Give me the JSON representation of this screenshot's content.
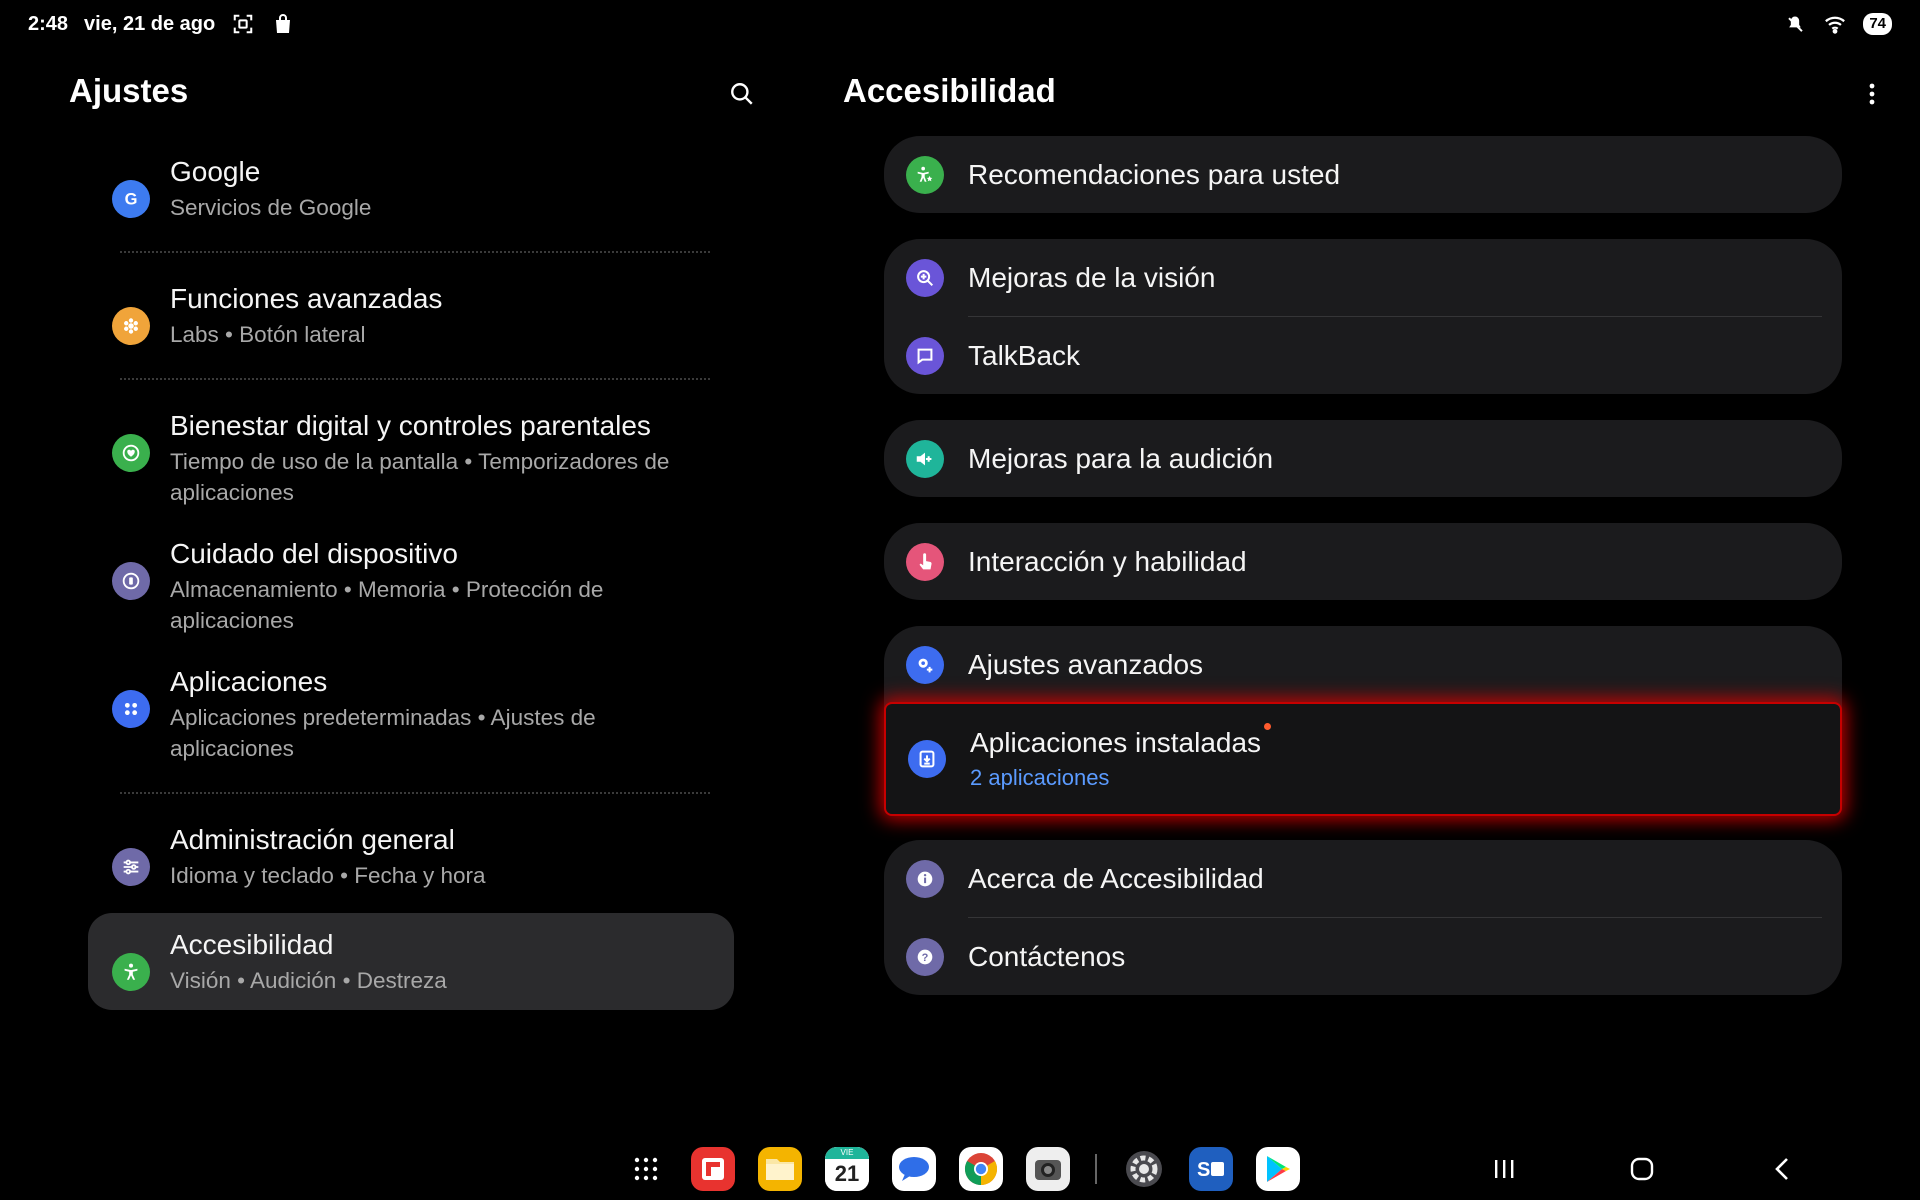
{
  "status_bar": {
    "time": "2:48",
    "date": "vie, 21 de ago",
    "battery": "74",
    "icons": [
      "screenshot-icon",
      "bag-icon",
      "mute-icon",
      "wifi-icon",
      "battery-icon"
    ]
  },
  "left_pane": {
    "title": "Ajustes",
    "items": [
      {
        "icon": "google-icon",
        "color": "#3d7bf0",
        "title": "Google",
        "subtitle": "Servicios de Google"
      },
      {
        "icon": "advanced-features-icon",
        "color": "#f0a43a",
        "title": "Funciones avanzadas",
        "subtitle": "Labs  •  Botón lateral"
      },
      {
        "icon": "digital-wellbeing-icon",
        "color": "#3ab04d",
        "title": "Bienestar digital y controles parentales",
        "subtitle": "Tiempo de uso de la pantalla  •  Temporizadores de aplicaciones"
      },
      {
        "icon": "device-care-icon",
        "color": "#6f6aa8",
        "title": "Cuidado del dispositivo",
        "subtitle": "Almacenamiento  •  Memoria  •  Protección de aplicaciones"
      },
      {
        "icon": "apps-icon",
        "color": "#3d6cf0",
        "title": "Aplicaciones",
        "subtitle": "Aplicaciones predeterminadas  •  Ajustes de aplicaciones"
      },
      {
        "icon": "general-management-icon",
        "color": "#6f6aa8",
        "title": "Administración general",
        "subtitle": "Idioma y teclado  •  Fecha y hora"
      },
      {
        "icon": "accessibility-icon",
        "color": "#3ab04d",
        "title": "Accesibilidad",
        "subtitle": "Visión  •  Audición  •  Destreza"
      }
    ]
  },
  "right_pane": {
    "title": "Accesibilidad",
    "items": [
      {
        "icon": "recommendations-icon",
        "color": "#3ab04d",
        "title": "Recomendaciones para usted"
      },
      {
        "icon": "vision-icon",
        "color": "#6a55d8",
        "title": "Mejoras de la visión"
      },
      {
        "icon": "talkback-icon",
        "color": "#6a55d8",
        "title": "TalkBack"
      },
      {
        "icon": "hearing-icon",
        "color": "#1fb59a",
        "title": "Mejoras para la audición"
      },
      {
        "icon": "interaction-icon",
        "color": "#e5557a",
        "title": "Interacción y habilidad"
      },
      {
        "icon": "advanced-settings-icon",
        "color": "#3d6cf0",
        "title": "Ajustes avanzados"
      },
      {
        "icon": "installed-apps-icon",
        "color": "#3d6cf0",
        "title": "Aplicaciones instaladas",
        "subtitle": "2 aplicaciones"
      },
      {
        "icon": "about-icon",
        "color": "#6f6aa8",
        "title": "Acerca de Accesibilidad"
      },
      {
        "icon": "contact-icon",
        "color": "#6f6aa8",
        "title": "Contáctenos"
      }
    ]
  },
  "taskbar": {
    "apps": [
      "app-drawer-icon",
      "flipboard-icon",
      "my-files-icon",
      "calendar-icon",
      "messages-icon",
      "chrome-icon",
      "camera-icon",
      "settings-icon",
      "smart-switch-icon",
      "play-store-icon"
    ],
    "calendar_day": "21",
    "calendar_weekday": "VIE"
  },
  "nav_bar": {
    "buttons": [
      "recents-button",
      "home-button",
      "back-button"
    ]
  }
}
